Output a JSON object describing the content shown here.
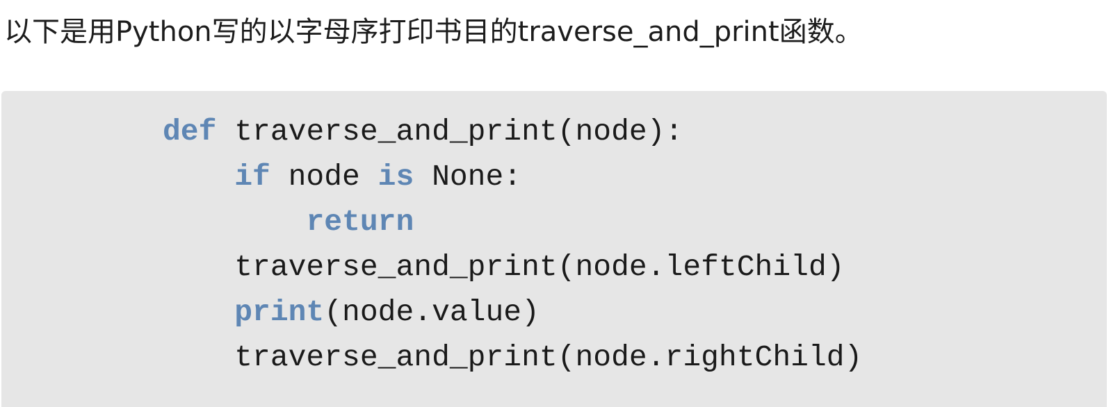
{
  "intro_text": "以下是用Python写的以字母序打印书目的traverse_and_print函数。",
  "code": {
    "line1": {
      "keyword": "def",
      "rest": " traverse_and_print(node):"
    },
    "line2": {
      "indent": "    ",
      "kw1": "if",
      "mid": " node ",
      "kw2": "is",
      "rest": " None:"
    },
    "line3": {
      "indent": "        ",
      "keyword": "return"
    },
    "line4": {
      "indent": "    ",
      "text": "traverse_and_print(node.leftChild)"
    },
    "line5": {
      "indent": "    ",
      "keyword": "print",
      "rest": "(node.value)"
    },
    "line6": {
      "indent": "    ",
      "text": "traverse_and_print(node.rightChild)"
    }
  },
  "colors": {
    "keyword": "#5e86b4",
    "code_background": "#e6e6e6",
    "text": "#1a1a1a"
  }
}
